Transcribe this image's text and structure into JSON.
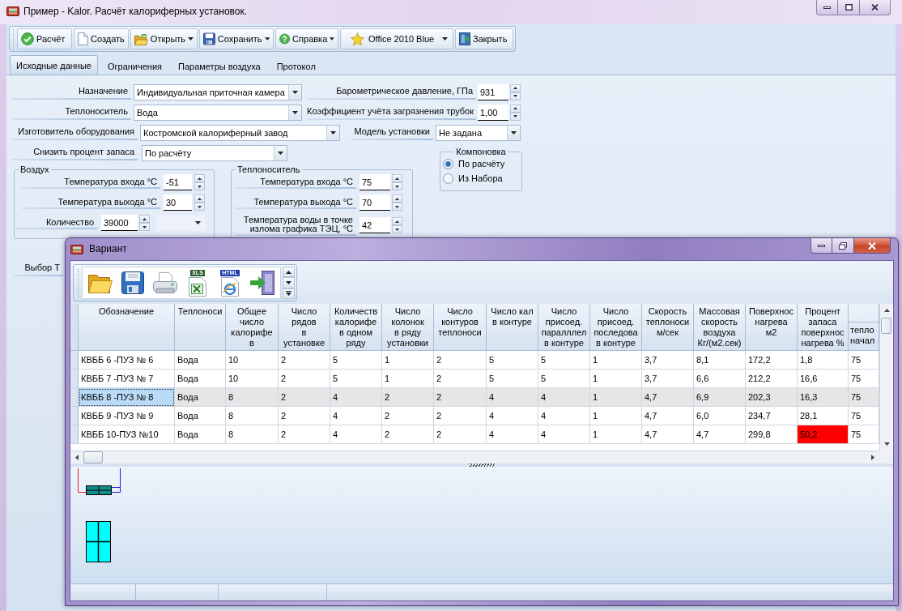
{
  "window": {
    "title": "Пример - Kalor. Расчёт калориферных установок."
  },
  "toolbar": [
    {
      "kind": "calc",
      "label": "Расчёт",
      "dropdown": false
    },
    {
      "kind": "new",
      "label": "Создать",
      "dropdown": false
    },
    {
      "kind": "open",
      "label": "Открыть",
      "dropdown": true
    },
    {
      "kind": "save",
      "label": "Сохранить",
      "dropdown": true
    },
    {
      "kind": "help",
      "label": "Справка",
      "dropdown": true
    },
    {
      "kind": "theme",
      "label": "Office 2010 Blue",
      "dropdown": true
    },
    {
      "kind": "exit",
      "label": "Закрыть",
      "dropdown": false
    }
  ],
  "tabs": [
    {
      "label": "Исходные данные",
      "selected": true
    },
    {
      "label": "Ограничения",
      "selected": false
    },
    {
      "label": "Параметры воздуха",
      "selected": false
    },
    {
      "label": "Протокол",
      "selected": false
    }
  ],
  "form": {
    "purpose": {
      "label": "Назначение",
      "value": "Индивидуальная приточная камера"
    },
    "barometric_pressure": {
      "label": "Барометрическое давление, ГПа",
      "value": "931"
    },
    "coolant": {
      "label": "Теплоноситель",
      "value": "Вода"
    },
    "fouling_factor": {
      "label": "Коэффициент учёта загрязнения трубок",
      "value": "1,00"
    },
    "manufacturer": {
      "label": "Изготовитель оборудования",
      "value": "Костромской калориферный завод"
    },
    "unit_model": {
      "label": "Модель установки",
      "value": "Не задана"
    },
    "reduce_reserve": {
      "label": "Снизить процент запаса",
      "value": "По расчёту"
    },
    "layout": {
      "title": "Компоновка",
      "options": [
        {
          "label": "По расчёту",
          "selected": true
        },
        {
          "label": "Из Набора",
          "selected": false
        }
      ]
    },
    "air": {
      "title": "Воздух",
      "fields": [
        {
          "label": "Температура входа °С",
          "value": "-51",
          "unit_dropdown": false
        },
        {
          "label": "Температура выхода °С",
          "value": "30",
          "unit_dropdown": false
        },
        {
          "label": "Количество",
          "value": "39000",
          "unit_dropdown": true
        }
      ]
    },
    "coolant_temps": {
      "title": "Теплоноситель",
      "fields": [
        {
          "label": "Температура входа °С",
          "value": "75"
        },
        {
          "label": "Температура выхода °С",
          "value": "70"
        },
        {
          "label": "Температура воды в точке излома графика ТЭЦ, °С",
          "value": "42"
        }
      ]
    },
    "covered_label": "Выбор Т"
  },
  "variant": {
    "title": "Вариант",
    "toolbar": [
      {
        "kind": "open"
      },
      {
        "kind": "save"
      },
      {
        "kind": "print"
      },
      {
        "kind": "xls",
        "tag": "XLS"
      },
      {
        "kind": "html",
        "tag": "HTML"
      },
      {
        "kind": "exit"
      }
    ],
    "table": {
      "columns": [
        {
          "lines": [
            "Обозначение"
          ],
          "kind": "plain"
        },
        {
          "lines": [
            "Теплоноси"
          ],
          "kind": "plain"
        },
        {
          "lines": [
            "Общее",
            "число",
            "калорифе",
            "в"
          ],
          "kind": "plain"
        },
        {
          "lines": [
            "Число",
            "рядов",
            "в",
            "установке"
          ],
          "kind": "plain"
        },
        {
          "lines": [
            "Количеств",
            "калорифе",
            "в одном",
            "ряду"
          ],
          "kind": "plain"
        },
        {
          "lines": [
            "Число",
            "колонок",
            "в ряду",
            "установки"
          ],
          "kind": "plain"
        },
        {
          "lines": [
            "Число",
            "контуров",
            "теплоноси"
          ],
          "kind": "plain"
        },
        {
          "lines": [
            "Число кал",
            "в контуре"
          ],
          "kind": "plain"
        },
        {
          "lines": [
            "Число",
            "присоед.",
            "паралллел",
            "в контуре"
          ],
          "kind": "plain"
        },
        {
          "lines": [
            "Число",
            "присоед.",
            "последова",
            "в контуре"
          ],
          "kind": "plain"
        },
        {
          "lines": [
            "Скорость",
            "теплоноси",
            "м/сек"
          ],
          "kind": "plain"
        },
        {
          "lines": [
            "Массовая",
            "скорость",
            "воздуха",
            "Кг/(м2.сек)"
          ],
          "kind": "plain"
        },
        {
          "lines": [
            "Поверхнос",
            "нагрева",
            "м2"
          ],
          "kind": "plain"
        },
        {
          "lines": [
            "Процент",
            "запаса",
            "поверхнос",
            "нагрева %"
          ],
          "kind": "reserve"
        },
        {
          "lines": [
            "тепло",
            "начал"
          ],
          "kind": "band"
        }
      ],
      "rows": [
        {
          "cells": [
            "КВББ 6 -ПУЗ № 6",
            "Вода",
            "10",
            "2",
            "5",
            "1",
            "2",
            "5",
            "5",
            "1",
            "3,7",
            "8,1",
            "172,2",
            "1,8",
            "75"
          ],
          "selected": false,
          "alert": false
        },
        {
          "cells": [
            "КВББ 7 -ПУЗ № 7",
            "Вода",
            "10",
            "2",
            "5",
            "1",
            "2",
            "5",
            "5",
            "1",
            "3,7",
            "6,6",
            "212,2",
            "16,6",
            "75"
          ],
          "selected": false,
          "alert": false
        },
        {
          "cells": [
            "КВББ 8 -ПУЗ № 8",
            "Вода",
            "8",
            "2",
            "4",
            "2",
            "2",
            "4",
            "4",
            "1",
            "4,7",
            "6,9",
            "202,3",
            "16,3",
            "75"
          ],
          "selected": true,
          "alert": false
        },
        {
          "cells": [
            "КВББ 9 -ПУЗ № 9",
            "Вода",
            "8",
            "2",
            "4",
            "2",
            "2",
            "4",
            "4",
            "1",
            "4,7",
            "6,0",
            "234,7",
            "28,1",
            "75"
          ],
          "selected": false,
          "alert": false
        },
        {
          "cells": [
            "КВББ 10-ПУЗ №10",
            "Вода",
            "8",
            "2",
            "4",
            "2",
            "2",
            "4",
            "4",
            "1",
            "4,7",
            "4,7",
            "299,8",
            "50,2",
            "75"
          ],
          "selected": false,
          "alert": true
        }
      ]
    }
  }
}
